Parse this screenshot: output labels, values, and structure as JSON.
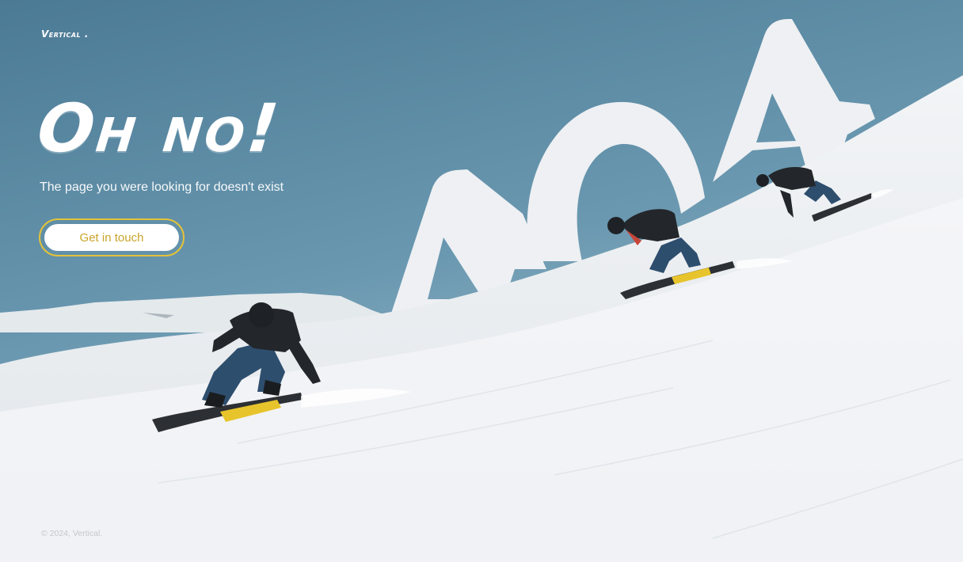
{
  "brand": {
    "logo": "Vertical ."
  },
  "hero": {
    "headline": "Oh no!",
    "message": "The page you were looking for doesn't exist",
    "cta_label": "Get in touch",
    "error_code": "404"
  },
  "footer": {
    "copyright": "© 2024, Vertical."
  },
  "colors": {
    "sky_top": "#3f6e8a",
    "sky_bottom": "#8fb6c8",
    "snow": "#f4f6f7",
    "accent": "#e2c23a",
    "cta_text": "#c9a52a"
  }
}
